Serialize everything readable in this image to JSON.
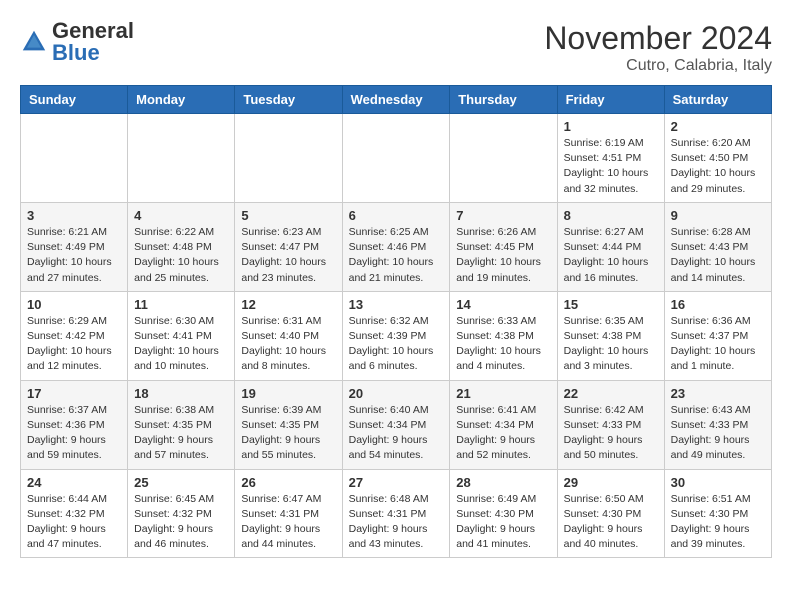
{
  "logo": {
    "general": "General",
    "blue": "Blue"
  },
  "header": {
    "month": "November 2024",
    "location": "Cutro, Calabria, Italy"
  },
  "weekdays": [
    "Sunday",
    "Monday",
    "Tuesday",
    "Wednesday",
    "Thursday",
    "Friday",
    "Saturday"
  ],
  "weeks": [
    [
      {
        "day": "",
        "info": ""
      },
      {
        "day": "",
        "info": ""
      },
      {
        "day": "",
        "info": ""
      },
      {
        "day": "",
        "info": ""
      },
      {
        "day": "",
        "info": ""
      },
      {
        "day": "1",
        "info": "Sunrise: 6:19 AM\nSunset: 4:51 PM\nDaylight: 10 hours and 32 minutes."
      },
      {
        "day": "2",
        "info": "Sunrise: 6:20 AM\nSunset: 4:50 PM\nDaylight: 10 hours and 29 minutes."
      }
    ],
    [
      {
        "day": "3",
        "info": "Sunrise: 6:21 AM\nSunset: 4:49 PM\nDaylight: 10 hours and 27 minutes."
      },
      {
        "day": "4",
        "info": "Sunrise: 6:22 AM\nSunset: 4:48 PM\nDaylight: 10 hours and 25 minutes."
      },
      {
        "day": "5",
        "info": "Sunrise: 6:23 AM\nSunset: 4:47 PM\nDaylight: 10 hours and 23 minutes."
      },
      {
        "day": "6",
        "info": "Sunrise: 6:25 AM\nSunset: 4:46 PM\nDaylight: 10 hours and 21 minutes."
      },
      {
        "day": "7",
        "info": "Sunrise: 6:26 AM\nSunset: 4:45 PM\nDaylight: 10 hours and 19 minutes."
      },
      {
        "day": "8",
        "info": "Sunrise: 6:27 AM\nSunset: 4:44 PM\nDaylight: 10 hours and 16 minutes."
      },
      {
        "day": "9",
        "info": "Sunrise: 6:28 AM\nSunset: 4:43 PM\nDaylight: 10 hours and 14 minutes."
      }
    ],
    [
      {
        "day": "10",
        "info": "Sunrise: 6:29 AM\nSunset: 4:42 PM\nDaylight: 10 hours and 12 minutes."
      },
      {
        "day": "11",
        "info": "Sunrise: 6:30 AM\nSunset: 4:41 PM\nDaylight: 10 hours and 10 minutes."
      },
      {
        "day": "12",
        "info": "Sunrise: 6:31 AM\nSunset: 4:40 PM\nDaylight: 10 hours and 8 minutes."
      },
      {
        "day": "13",
        "info": "Sunrise: 6:32 AM\nSunset: 4:39 PM\nDaylight: 10 hours and 6 minutes."
      },
      {
        "day": "14",
        "info": "Sunrise: 6:33 AM\nSunset: 4:38 PM\nDaylight: 10 hours and 4 minutes."
      },
      {
        "day": "15",
        "info": "Sunrise: 6:35 AM\nSunset: 4:38 PM\nDaylight: 10 hours and 3 minutes."
      },
      {
        "day": "16",
        "info": "Sunrise: 6:36 AM\nSunset: 4:37 PM\nDaylight: 10 hours and 1 minute."
      }
    ],
    [
      {
        "day": "17",
        "info": "Sunrise: 6:37 AM\nSunset: 4:36 PM\nDaylight: 9 hours and 59 minutes."
      },
      {
        "day": "18",
        "info": "Sunrise: 6:38 AM\nSunset: 4:35 PM\nDaylight: 9 hours and 57 minutes."
      },
      {
        "day": "19",
        "info": "Sunrise: 6:39 AM\nSunset: 4:35 PM\nDaylight: 9 hours and 55 minutes."
      },
      {
        "day": "20",
        "info": "Sunrise: 6:40 AM\nSunset: 4:34 PM\nDaylight: 9 hours and 54 minutes."
      },
      {
        "day": "21",
        "info": "Sunrise: 6:41 AM\nSunset: 4:34 PM\nDaylight: 9 hours and 52 minutes."
      },
      {
        "day": "22",
        "info": "Sunrise: 6:42 AM\nSunset: 4:33 PM\nDaylight: 9 hours and 50 minutes."
      },
      {
        "day": "23",
        "info": "Sunrise: 6:43 AM\nSunset: 4:33 PM\nDaylight: 9 hours and 49 minutes."
      }
    ],
    [
      {
        "day": "24",
        "info": "Sunrise: 6:44 AM\nSunset: 4:32 PM\nDaylight: 9 hours and 47 minutes."
      },
      {
        "day": "25",
        "info": "Sunrise: 6:45 AM\nSunset: 4:32 PM\nDaylight: 9 hours and 46 minutes."
      },
      {
        "day": "26",
        "info": "Sunrise: 6:47 AM\nSunset: 4:31 PM\nDaylight: 9 hours and 44 minutes."
      },
      {
        "day": "27",
        "info": "Sunrise: 6:48 AM\nSunset: 4:31 PM\nDaylight: 9 hours and 43 minutes."
      },
      {
        "day": "28",
        "info": "Sunrise: 6:49 AM\nSunset: 4:30 PM\nDaylight: 9 hours and 41 minutes."
      },
      {
        "day": "29",
        "info": "Sunrise: 6:50 AM\nSunset: 4:30 PM\nDaylight: 9 hours and 40 minutes."
      },
      {
        "day": "30",
        "info": "Sunrise: 6:51 AM\nSunset: 4:30 PM\nDaylight: 9 hours and 39 minutes."
      }
    ]
  ]
}
